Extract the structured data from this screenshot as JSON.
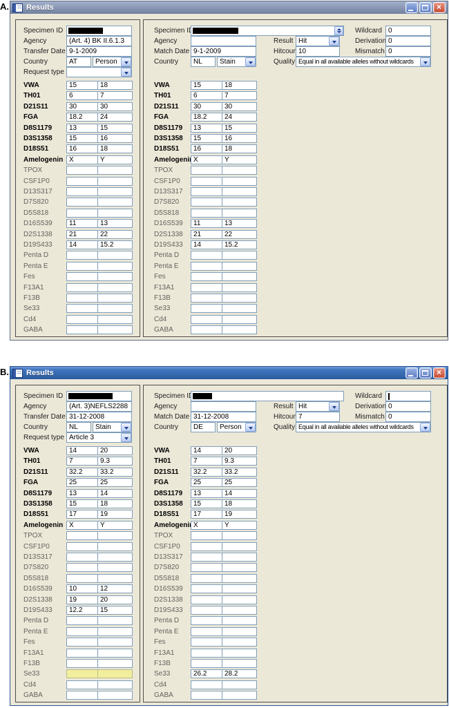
{
  "figure": {
    "label_a": "A.",
    "label_b": "B."
  },
  "window_title": "Results",
  "labels": {
    "specimen_id": "Specimen ID",
    "agency": "Agency",
    "transfer_date": "Transfer Date",
    "match_date": "Match Date",
    "country": "Country",
    "request_type": "Request type",
    "result": "Result",
    "hitcount": "Hitcount",
    "quality": "Quality",
    "wildcard": "Wildcard",
    "derivation": "Derivation",
    "mismatch": "Mismatch"
  },
  "markers": [
    "VWA",
    "TH01",
    "D21S11",
    "FGA",
    "D8S1179",
    "D3S1358",
    "D18S51",
    "Amelogenin",
    "TPOX",
    "CSF1P0",
    "D13S317",
    "D7S820",
    "D5S818",
    "D16S539",
    "D2S1338",
    "D19S433",
    "Penta D",
    "Penta E",
    "Fes",
    "F13A1",
    "F13B",
    "Se33",
    "Cd4",
    "GABA"
  ],
  "highlight_color": "#f1ef9e",
  "windows": [
    {
      "id": "A",
      "left": {
        "specimen_id_redacted": true,
        "agency": "(Art. 4) BK II.6.1.3",
        "transfer_date": "9-1-2009",
        "country_code": "AT",
        "country_type": "Person",
        "request_type": "",
        "highlighted": [],
        "alleles": [
          [
            "15",
            "18"
          ],
          [
            "6",
            "7"
          ],
          [
            "30",
            "30"
          ],
          [
            "18.2",
            "24"
          ],
          [
            "13",
            "15"
          ],
          [
            "15",
            "16"
          ],
          [
            "16",
            "18"
          ],
          [
            "X",
            "Y"
          ],
          [
            "",
            ""
          ],
          [
            "",
            ""
          ],
          [
            "",
            ""
          ],
          [
            "",
            ""
          ],
          [
            "",
            ""
          ],
          [
            "11",
            "13"
          ],
          [
            "21",
            "22"
          ],
          [
            "14",
            "15.2"
          ],
          [
            "",
            ""
          ],
          [
            "",
            ""
          ],
          [
            "",
            ""
          ],
          [
            "",
            ""
          ],
          [
            "",
            ""
          ],
          [
            "",
            ""
          ],
          [
            "",
            ""
          ],
          [
            "",
            ""
          ]
        ]
      },
      "right": {
        "specimen_id_redacted": true,
        "agency": "",
        "match_date": "9-1-2009",
        "country_code": "NL",
        "country_type": "Stain",
        "result": "Hit",
        "hitcount": "10",
        "quality": "Equal in all available alleles without wildcards",
        "wildcard": "0",
        "derivation": "0",
        "mismatch": "0",
        "highlighted": [],
        "alleles": [
          [
            "15",
            "18"
          ],
          [
            "6",
            "7"
          ],
          [
            "30",
            "30"
          ],
          [
            "18.2",
            "24"
          ],
          [
            "13",
            "15"
          ],
          [
            "15",
            "16"
          ],
          [
            "16",
            "18"
          ],
          [
            "X",
            "Y"
          ],
          [
            "",
            ""
          ],
          [
            "",
            ""
          ],
          [
            "",
            ""
          ],
          [
            "",
            ""
          ],
          [
            "",
            ""
          ],
          [
            "11",
            "13"
          ],
          [
            "21",
            "22"
          ],
          [
            "14",
            "15.2"
          ],
          [
            "",
            ""
          ],
          [
            "",
            ""
          ],
          [
            "",
            ""
          ],
          [
            "",
            ""
          ],
          [
            "",
            ""
          ],
          [
            "",
            ""
          ],
          [
            "",
            ""
          ],
          [
            "",
            ""
          ]
        ]
      }
    },
    {
      "id": "B",
      "left": {
        "specimen_id_redacted": true,
        "agency": "(Art. 3)NEFLS2288",
        "transfer_date": "31-12-2008",
        "country_code": "NL",
        "country_type": "Stain",
        "request_type": "Article 3",
        "highlighted": [
          "Se33"
        ],
        "alleles": [
          [
            "14",
            "20"
          ],
          [
            "7",
            "9.3"
          ],
          [
            "32.2",
            "33.2"
          ],
          [
            "25",
            "25"
          ],
          [
            "13",
            "14"
          ],
          [
            "15",
            "18"
          ],
          [
            "17",
            "19"
          ],
          [
            "X",
            "Y"
          ],
          [
            "",
            ""
          ],
          [
            "",
            ""
          ],
          [
            "",
            ""
          ],
          [
            "",
            ""
          ],
          [
            "",
            ""
          ],
          [
            "10",
            "12"
          ],
          [
            "19",
            "20"
          ],
          [
            "12.2",
            "15"
          ],
          [
            "",
            ""
          ],
          [
            "",
            ""
          ],
          [
            "",
            ""
          ],
          [
            "",
            ""
          ],
          [
            "",
            ""
          ],
          [
            "",
            ""
          ],
          [
            "",
            ""
          ],
          [
            "",
            ""
          ]
        ]
      },
      "right": {
        "specimen_id_redacted": true,
        "agency": "",
        "match_date": "31-12-2008",
        "country_code": "DE",
        "country_type": "Person",
        "result": "Hit",
        "hitcount": "7",
        "quality": "Equal in all available alleles without wildcards",
        "wildcard": "",
        "derivation": "0",
        "mismatch": "0",
        "highlighted": [],
        "alleles": [
          [
            "14",
            "20"
          ],
          [
            "7",
            "9.3"
          ],
          [
            "32.2",
            "33.2"
          ],
          [
            "25",
            "25"
          ],
          [
            "13",
            "14"
          ],
          [
            "15",
            "18"
          ],
          [
            "17",
            "19"
          ],
          [
            "X",
            "Y"
          ],
          [
            "",
            ""
          ],
          [
            "",
            ""
          ],
          [
            "",
            ""
          ],
          [
            "",
            ""
          ],
          [
            "",
            ""
          ],
          [
            "",
            ""
          ],
          [
            "",
            ""
          ],
          [
            "",
            ""
          ],
          [
            "",
            ""
          ],
          [
            "",
            ""
          ],
          [
            "",
            ""
          ],
          [
            "",
            ""
          ],
          [
            "",
            ""
          ],
          [
            "26.2",
            "28.2"
          ],
          [
            "",
            ""
          ],
          [
            "",
            ""
          ]
        ]
      }
    }
  ]
}
